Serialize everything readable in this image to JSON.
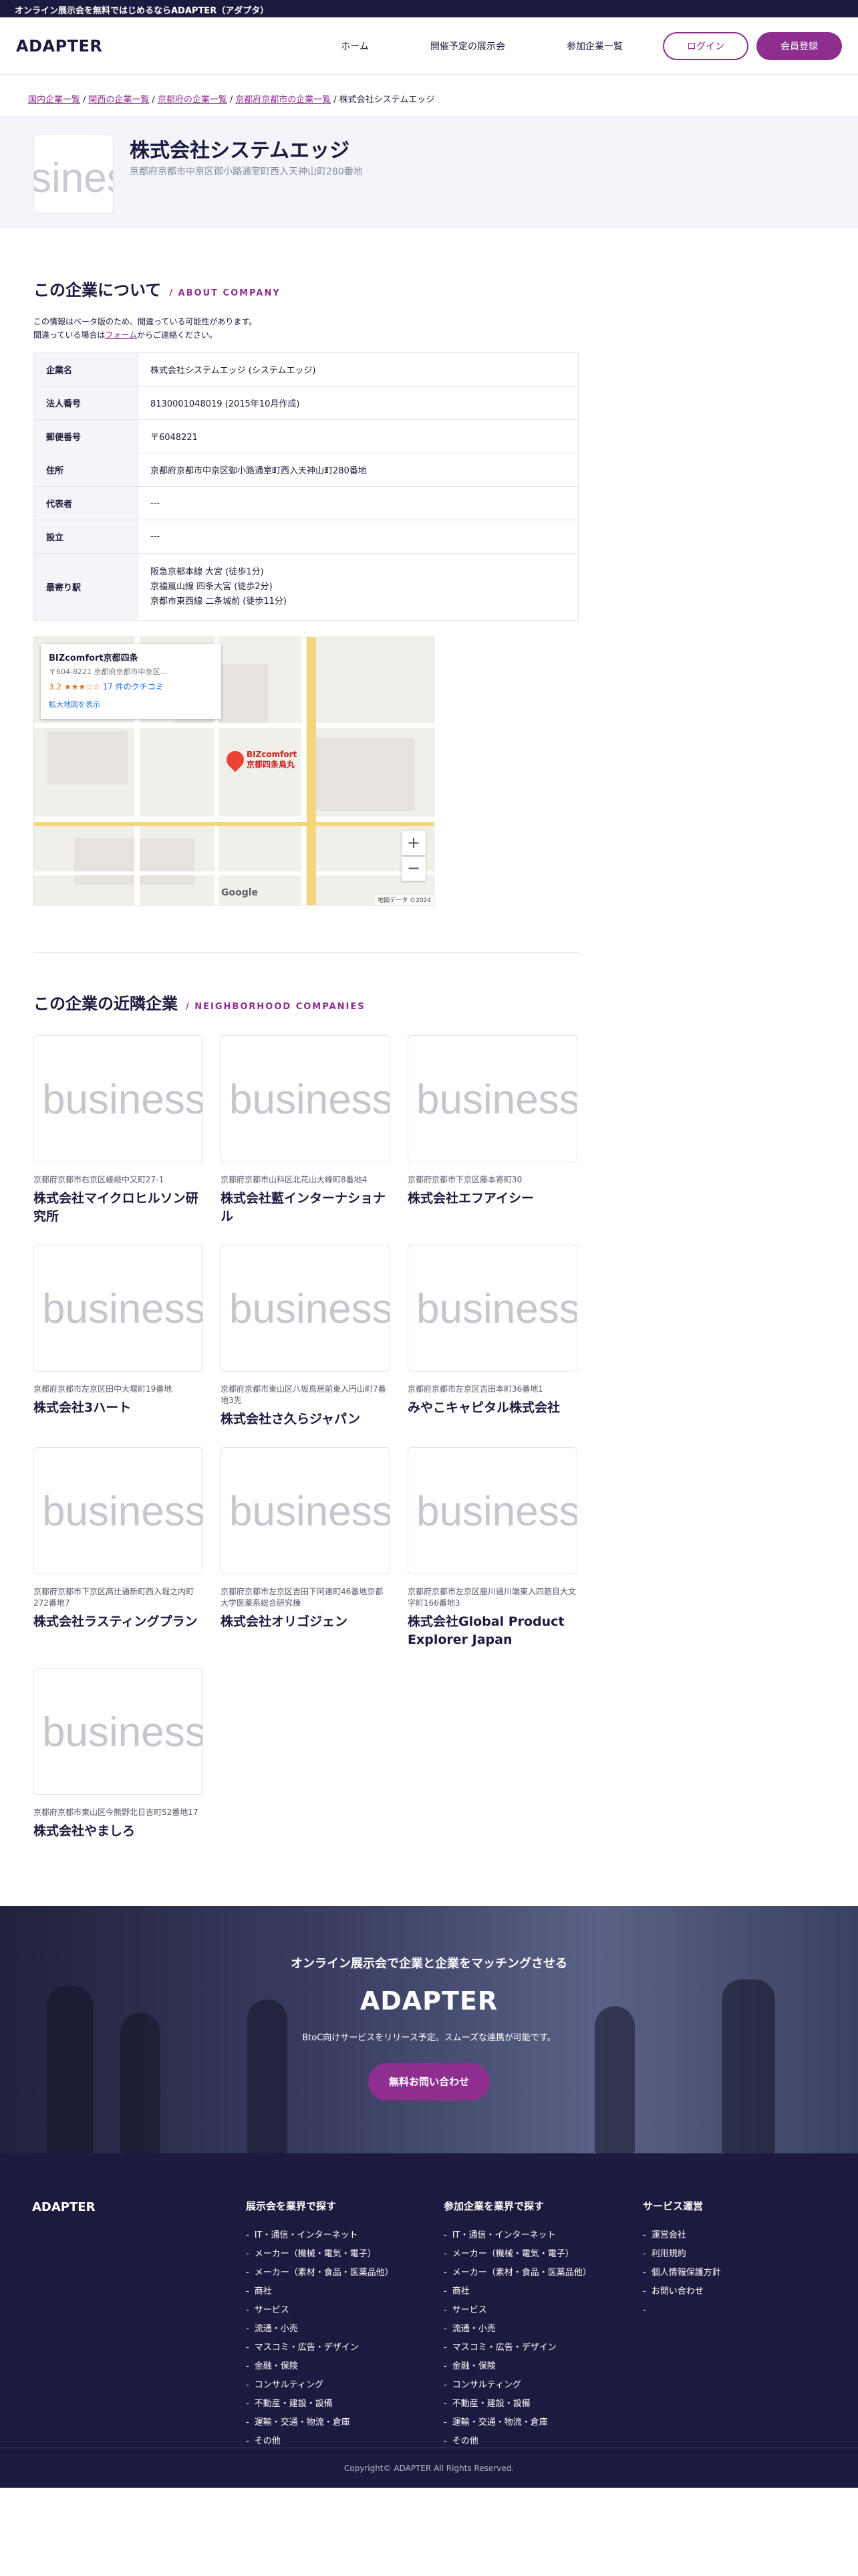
{
  "topbar": {
    "text": "オンライン展示会を無料ではじめるならADAPTER（アダプタ）"
  },
  "header": {
    "logo": "ADAPTER",
    "nav": [
      "ホーム",
      "開催予定の展示会",
      "参加企業一覧"
    ],
    "login": "ログイン",
    "register": "会員登録"
  },
  "breadcrumb": {
    "links": [
      "国内企業一覧",
      "関西の企業一覧",
      "京都府の企業一覧",
      "京都府京都市の企業一覧"
    ],
    "current": "株式会社システムエッジ"
  },
  "hero": {
    "logo_text": "business",
    "name": "株式会社システムエッジ",
    "address": "京都府京都市中京区御小路通室町西入天神山町280番地"
  },
  "about": {
    "title": "この企業について",
    "subtitle": "/ ABOUT COMPANY",
    "note_line1": "この情報はベータ版のため、間違っている可能性があります。",
    "note_line2_pre": "間違っている場合は",
    "note_link": "フォーム",
    "note_line2_post": "からご連絡ください。",
    "rows": [
      {
        "key": "企業名",
        "value": "株式会社システムエッジ (システムエッジ)"
      },
      {
        "key": "法人番号",
        "value": "8130001048019 (2015年10月作成)"
      },
      {
        "key": "郵便番号",
        "value": "〒6048221"
      },
      {
        "key": "住所",
        "value": "京都府京都市中京区御小路通室町西入天神山町280番地"
      },
      {
        "key": "代表者",
        "value": "---"
      },
      {
        "key": "設立",
        "value": "---"
      }
    ],
    "station_key": "最寄り駅",
    "stations": [
      "阪急京都本線 大宮 (徒歩1分)",
      "京福嵐山線 四条大宮 (徒歩2分)",
      "京都市東西線 二条城前 (徒歩11分)"
    ]
  },
  "map": {
    "place_name": "BIZcomfort京都四条",
    "place_addr": "〒604-8221 京都府京都市中京区...",
    "rating": "3.2 ★★★☆☆",
    "reviews": "17 件のクチコミ",
    "link": "拡大地図を表示",
    "pin_line1": "BIZcomfort",
    "pin_line2": "京都四条烏丸",
    "google": "Google",
    "footer": "地図データ ©2024"
  },
  "neighbors": {
    "title": "この企業の近隣企業",
    "subtitle": "/ NEIGHBORHOOD COMPANIES",
    "logo_text": "business",
    "items": [
      {
        "address": "京都府京都市右京区嵯峨中又町27-1",
        "name": "株式会社マイクロヒルソン研究所"
      },
      {
        "address": "京都府京都市山科区北花山大峰町8番地4",
        "name": "株式会社藍インターナショナル"
      },
      {
        "address": "京都府京都市下京区藤本寄町30",
        "name": "株式会社エフアイシー"
      },
      {
        "address": "京都府京都市左京区田中大堰町19番地",
        "name": "株式会社3ハート"
      },
      {
        "address": "京都府京都市東山区八坂鳥居前東入円山町7番地3先",
        "name": "株式会社さ久らジャパン"
      },
      {
        "address": "京都府京都市左京区吉田本町36番地1",
        "name": "みやこキャピタル株式会社"
      },
      {
        "address": "京都府京都市下京区高辻通新町西入堀之内町272番地7",
        "name": "株式会社ラスティングプラン"
      },
      {
        "address": "京都府京都市左京区吉田下阿達町46番地京都大学医薬系総合研究棟",
        "name": "株式会社オリゴジェン"
      },
      {
        "address": "京都府京都市左京区鹿川通川端東入四筋目大文字町166番地3",
        "name": "株式会社Global Product Explorer Japan"
      },
      {
        "address": "京都府京都市東山区今熊野北日吉町52番地17",
        "name": "株式会社やましろ"
      }
    ]
  },
  "cta": {
    "subtitle": "オンライン展示会で企業と企業をマッチングさせる",
    "title": "ADAPTER",
    "description": "BtoC向けサービスをリリース予定。スムーズな連携が可能です。",
    "button": "無料お問い合わせ"
  },
  "footer": {
    "logo": "ADAPTER",
    "col1_title": "展示会を業界で探す",
    "col2_title": "参加企業を業界で探す",
    "industries": [
      "IT・通信・インターネット",
      "メーカー（機械・電気・電子）",
      "メーカー（素材・食品・医薬品他）",
      "商社",
      "サービス",
      "流通・小売",
      "マスコミ・広告・デザイン",
      "金融・保険",
      "コンサルティング",
      "不動産・建設・設備",
      "運輸・交通・物流・倉庫",
      "その他"
    ],
    "col3_title": "サービス運営",
    "service": [
      "運営会社",
      "利用規約",
      "個人情報保護方針",
      "お問い合わせ",
      ""
    ],
    "copyright": "Copyright© ADAPTER All Rights Reserved."
  }
}
